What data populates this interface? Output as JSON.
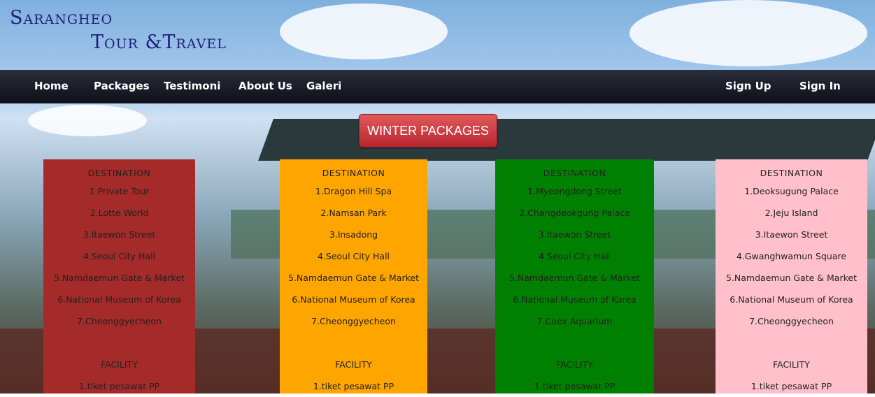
{
  "brand": {
    "line1": "Sarangheo",
    "line2": "Tour &Travel"
  },
  "nav": {
    "items": [
      "Home",
      "Packages",
      "Testimoni",
      "About Us",
      "Galeri"
    ],
    "right": [
      "Sign Up",
      "Sign In"
    ]
  },
  "cta": "WINTER PACKAGES",
  "packages": [
    {
      "color": "#a52a2a",
      "dest_title": "DESTINATION",
      "destinations": [
        "1.Private Tour",
        "2.Lotte World",
        "3.Itaewon Street",
        "4.Seoul City Hall",
        "5.Namdaemun Gate & Market",
        "6.National Museum of Korea",
        "7.Cheonggyecheon"
      ],
      "fac_title": "FACILITY",
      "facilities": [
        "1.tiket pesawat PP"
      ]
    },
    {
      "color": "#ffa500",
      "dest_title": "DESTINATION",
      "destinations": [
        "1.Dragon Hill Spa",
        "2.Namsan Park",
        "3.Insadong",
        "4.Seoul City Hall",
        "5.Namdaemun Gate & Market",
        "6.National Museum of Korea",
        "7.Cheonggyecheon"
      ],
      "fac_title": "FACILITY",
      "facilities": [
        "1.tiket pesawat PP"
      ]
    },
    {
      "color": "#008000",
      "dest_title": "DESTINATION",
      "destinations": [
        "1.Myeongdong Street",
        "2.Changdeokgung Palace",
        "3.Itaewon Street",
        "4.Seoul City Hall",
        "5.Namdaemun Gate & Market",
        "6.National Museum of Korea",
        "7.Coex Aquarium"
      ],
      "fac_title": "FACILITY",
      "facilities": [
        "1.tiket pesawat PP"
      ]
    },
    {
      "color": "#ffc0cb",
      "dest_title": "DESTINATION",
      "destinations": [
        "1.Deoksugung Palace",
        "2.Jeju Island",
        "3.Itaewon Street",
        "4.Gwanghwamun Square",
        "5.Namdaemun Gate & Market",
        "6.National Museum of Korea",
        "7.Cheonggyecheon"
      ],
      "fac_title": "FACILITY",
      "facilities": [
        "1.tiket pesawat PP"
      ]
    }
  ]
}
